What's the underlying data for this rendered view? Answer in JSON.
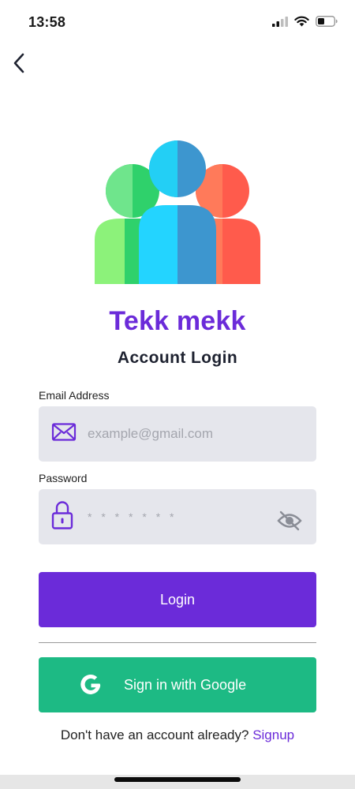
{
  "status_bar": {
    "time": "13:58",
    "icons": [
      "signal-icon",
      "wifi-icon",
      "battery-icon"
    ]
  },
  "nav": {
    "back_icon": "chevron-left-icon"
  },
  "logo": {
    "icon": "users-group-icon"
  },
  "app_title": "Tekk mekk",
  "page_title": "Account Login",
  "email": {
    "label": "Email Address",
    "placeholder": "example@gmail.com",
    "value": "",
    "icon": "envelope-icon"
  },
  "password": {
    "label": "Password",
    "placeholder": "* * * * * * *",
    "value": "",
    "icon": "lock-icon",
    "visibility_icon": "eye-off-icon"
  },
  "login_button": {
    "label": "Login"
  },
  "google_button": {
    "label": "Sign in with Google",
    "icon": "google-icon"
  },
  "signup": {
    "prompt": "Don't have an account already?",
    "link_label": "Signup"
  },
  "colors": {
    "primary": "#6b2bd9",
    "google": "#1dba84",
    "field_bg": "#e5e6ec"
  }
}
